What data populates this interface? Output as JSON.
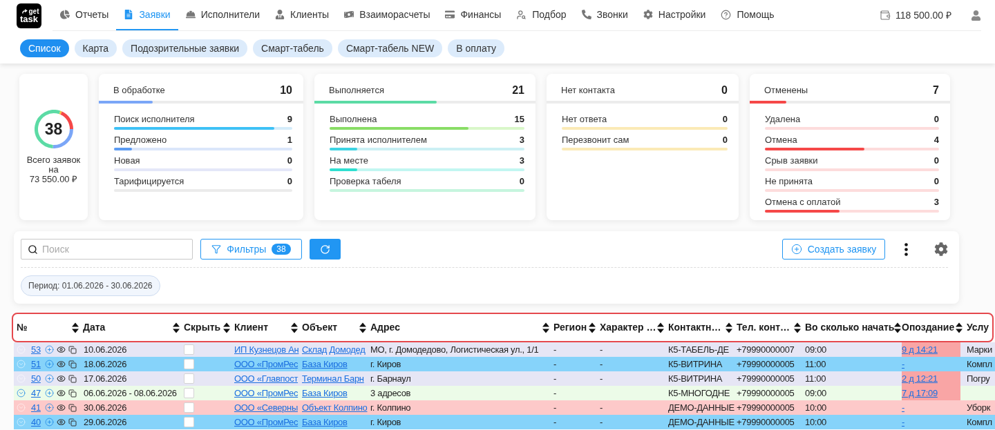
{
  "logo": {
    "top": "get",
    "bottom": "task"
  },
  "nav": {
    "items": [
      {
        "label": "Отчеты",
        "selected": false
      },
      {
        "label": "Заявки",
        "selected": true
      },
      {
        "label": "Исполнители",
        "selected": false
      },
      {
        "label": "Клиенты",
        "selected": false
      },
      {
        "label": "Взаиморасчеты",
        "selected": false
      },
      {
        "label": "Финансы",
        "selected": false
      },
      {
        "label": "Подбор",
        "selected": false
      },
      {
        "label": "Звонки",
        "selected": false
      },
      {
        "label": "Настройки",
        "selected": false
      },
      {
        "label": "Помощь",
        "selected": false
      }
    ],
    "balance": "118 500.00 ₽"
  },
  "subtabs": [
    {
      "label": "Список",
      "selected": true
    },
    {
      "label": "Карта",
      "selected": false
    },
    {
      "label": "Подозрительные заявки",
      "selected": false
    },
    {
      "label": "Смарт-табель",
      "selected": false
    },
    {
      "label": "Смарт-табель NEW",
      "selected": false
    },
    {
      "label": "В оплату",
      "selected": false
    }
  ],
  "summary": {
    "total": "38",
    "caption": "Всего заявок на 73 550.00 ₽"
  },
  "groups": [
    {
      "title": "В обработке",
      "count": "10",
      "level": 0.263,
      "color": "#7ba6f7",
      "items": [
        {
          "label": "Поиск исполнителя",
          "count": "9",
          "track": {
            "color": "#d4ecfa"
          },
          "fill": {
            "level": 0.9,
            "color": "#3ec1f6"
          }
        },
        {
          "label": "Предложено",
          "count": "1",
          "track": {
            "color": "#dbe6fa"
          },
          "fill": {
            "level": 0.1,
            "color": "#5b9bf3"
          }
        },
        {
          "label": "Новая",
          "count": "0",
          "track": {
            "color": "#e4e7f8"
          }
        },
        {
          "label": "Тарифицируется",
          "count": "0",
          "track": {
            "color": "#ebebeb"
          }
        }
      ]
    },
    {
      "title": "Выполняется",
      "count": "21",
      "level": 0.553,
      "color": "#5cdba5",
      "items": [
        {
          "label": "Выполнена",
          "count": "15",
          "track": {
            "color": "#d9f7c9"
          },
          "fill": {
            "level": 0.714,
            "color": "#89dd66"
          }
        },
        {
          "label": "Принята исполнителем",
          "count": "3",
          "track": {
            "color": "#ccf0f4"
          },
          "fill": {
            "level": 0.143,
            "color": "#3dd3e2"
          }
        },
        {
          "label": "На месте",
          "count": "3",
          "track": {
            "color": "#c2f6f1"
          },
          "fill": {
            "level": 0.143,
            "color": "#2fdfd0"
          }
        },
        {
          "label": "Проверка табеля",
          "count": "0",
          "track": {
            "color": "#c6f5de"
          }
        }
      ]
    },
    {
      "title": "Нет контакта",
      "count": "0",
      "color": "#f3c740",
      "items": [
        {
          "label": "Нет ответа",
          "count": "0",
          "track": {
            "color": "#fbeab6"
          }
        },
        {
          "label": "Перезвонит сам",
          "count": "0",
          "track": {
            "color": "#fbeab6"
          }
        }
      ]
    },
    {
      "title": "Отменены",
      "count": "7",
      "level": 0.184,
      "color": "#f54848",
      "items": [
        {
          "label": "Удалена",
          "count": "0",
          "track": {
            "color": "#fddcdc"
          }
        },
        {
          "label": "Отмена",
          "count": "4",
          "track": {
            "color": "#fddcdc"
          },
          "fill": {
            "level": 0.571,
            "color": "#f54848"
          }
        },
        {
          "label": "Срыв заявки",
          "count": "0",
          "track": {
            "color": "#fddcdc"
          }
        },
        {
          "label": "Не принята",
          "count": "0",
          "track": {
            "color": "#fddcdc"
          }
        },
        {
          "label": "Отмена с оплатой",
          "count": "3",
          "track": {
            "color": "#fddcdc"
          },
          "fill": {
            "level": 0.429,
            "color": "#f54848"
          }
        }
      ]
    }
  ],
  "toolbar": {
    "search": {
      "placeholder": "Поиск"
    },
    "filters": {
      "label": "Фильтры",
      "count": "38"
    },
    "create_button": "Создать заявку",
    "period": "Период: 01.06.2026 - 30.06.2026"
  },
  "table": {
    "columns": [
      "№",
      "Дата",
      "Скрыть",
      "Клиент",
      "Объект",
      "Адрес",
      "Регион",
      "Характер …",
      "Контактн…",
      "Тел. конт…",
      "Во сколько начать",
      "Опоздание",
      "Услу"
    ],
    "rows": [
      {
        "color": "#e6e6f5",
        "expandable": false,
        "number": "53",
        "date": "10.06.2026",
        "hide_checked": false,
        "client": "ИП Кузнецов Ан",
        "object": "Склад Домодед",
        "address": "МО, г. Домодедово, Логистическая ул., 1/1",
        "region": "-",
        "character": "-",
        "contact": "К5-ТАБЕЛЬ-ДЕ",
        "phone": "+79990000007",
        "start_time": "09:00",
        "delay": "9 д 14:21",
        "overdue": true,
        "service": "Марки"
      },
      {
        "color": "#86d3fa",
        "expandable": false,
        "number": "51",
        "date": "18.06.2026",
        "hide_checked": false,
        "client": "ООО «ПромРес",
        "object": "База Киров",
        "address": "г. Киров",
        "region": "-",
        "character": "-",
        "contact": "К5-ВИТРИНА",
        "phone": "+79990000005",
        "start_time": "11:00",
        "delay": "-",
        "overdue": false,
        "service": "Компл"
      },
      {
        "color": "#e6e6f5",
        "expandable": false,
        "number": "50",
        "date": "17.06.2026",
        "hide_checked": false,
        "client": "ООО «Главпост",
        "object": "Терминал Барн",
        "address": "г. Барнаул",
        "region": "-",
        "character": "-",
        "contact": "К5-ВИТРИНА",
        "phone": "+79990000005",
        "start_time": "11:00",
        "delay": "2 д 12:21",
        "overdue": true,
        "service": "Погру"
      },
      {
        "color": "#ecfbe8",
        "expandable": true,
        "number": "47",
        "date": "06.06.2026 - 08.06.2026",
        "hide_checked": false,
        "client": "ООО «ПромРес",
        "object": "База Киров",
        "address": "3 адресов",
        "region": "-",
        "contact": "К5-МНОГОДНЕ",
        "phone": "+79990000005",
        "start_time": "09:00",
        "delay": "7 д 17:09",
        "overdue": true
      },
      {
        "color": "#fdc9c9",
        "expandable": false,
        "number": "41",
        "date": "30.06.2026",
        "hide_checked": false,
        "client": "ООО «Северны",
        "object": "Объект Колпино",
        "address": "г. Колпино",
        "region": "-",
        "character": "-",
        "contact": "ДЕМО-ДАННЫЕ",
        "phone": "+79990000005",
        "start_time": "10:00",
        "delay": "-",
        "overdue": false,
        "service": "Уборк"
      },
      {
        "color": "#86d3fa",
        "expandable": false,
        "number": "40",
        "date": "29.06.2026",
        "hide_checked": false,
        "client": "ООО «ПромРес",
        "object": "База Киров",
        "address": "г. Киров",
        "region": "-",
        "character": "-",
        "contact": "ДЕМО-ДАННЫЕ",
        "phone": "+79990000005",
        "start_time": "10:00",
        "delay": "-",
        "overdue": false,
        "service": "Компл"
      }
    ]
  }
}
